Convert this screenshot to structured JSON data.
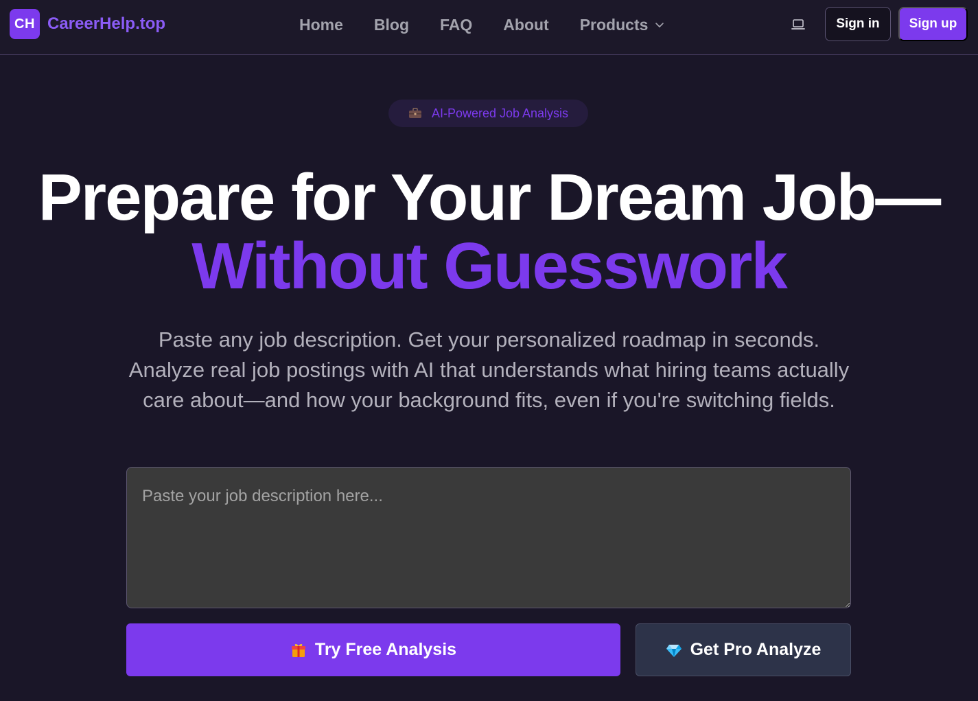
{
  "nav": {
    "logo_text": "CH",
    "brand_name": "CareerHelp.top",
    "links": [
      {
        "label": "Home"
      },
      {
        "label": "Blog"
      },
      {
        "label": "FAQ"
      },
      {
        "label": "About"
      },
      {
        "label": "Products"
      }
    ],
    "theme_icon": "laptop-icon",
    "sign_in": "Sign in",
    "sign_up": "Sign up"
  },
  "hero": {
    "badge_icon": "briefcase-icon",
    "badge_text": "AI-Powered Job Analysis",
    "headline_line1": "Prepare for Your Dream Job—",
    "headline_line2": "Without Guesswork",
    "description": "Paste any job description. Get your personalized roadmap in seconds. Analyze real job postings with AI that understands what hiring teams actually care about—and how your background fits, even if you're switching fields.",
    "input_placeholder": "Paste your job description here...",
    "input_value": "",
    "free_button_icon": "gift-icon",
    "free_button_label": "Try Free Analysis",
    "pro_button_icon": "gem-icon",
    "pro_button_label": "Get Pro Analyze"
  },
  "colors": {
    "background": "#1a1628",
    "accent": "#7c3aed",
    "brand_text": "#8b5cf6",
    "nav_text": "#a3a3ad",
    "description_text": "#b3b1bc",
    "input_bg": "#3a3a3a",
    "pro_button_bg": "#2d3349"
  }
}
